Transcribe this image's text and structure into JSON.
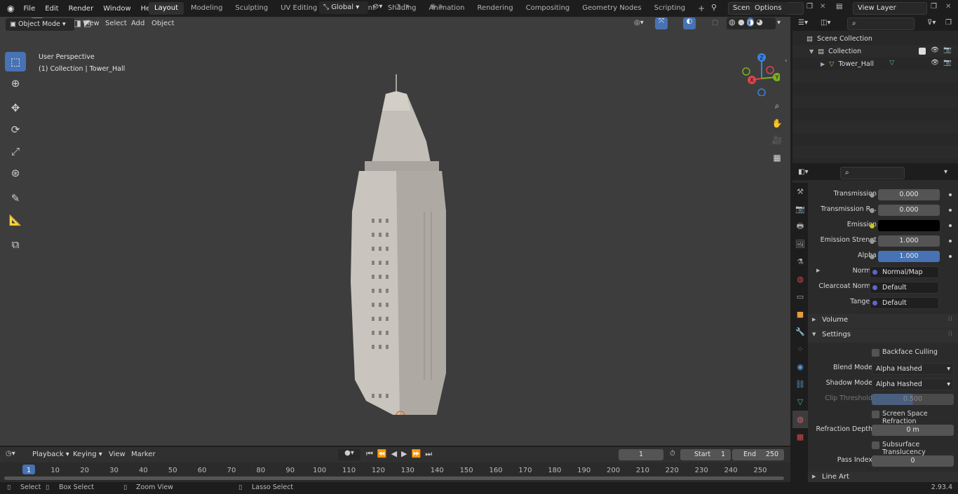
{
  "menu": [
    "File",
    "Edit",
    "Render",
    "Window",
    "Help"
  ],
  "workspaces": [
    "Layout",
    "Modeling",
    "Sculpting",
    "UV Editing",
    "Texture Paint",
    "Shading",
    "Animation",
    "Rendering",
    "Compositing",
    "Geometry Nodes",
    "Scripting"
  ],
  "scene_name": "Scene",
  "view_layer": "View Layer",
  "header": {
    "transform_orientation": "Global",
    "options": "Options"
  },
  "viewport_header": {
    "mode": "Object Mode",
    "view": "View",
    "select": "Select",
    "add": "Add",
    "object": "Object"
  },
  "viewport": {
    "perspective": "User Perspective",
    "context": "(1) Collection | Tower_Hall",
    "gizmo_z": "Z",
    "gizmo_y": "Y",
    "gizmo_x": "X"
  },
  "outliner": {
    "scene_collection": "Scene Collection",
    "collection": "Collection",
    "object": "Tower_Hall"
  },
  "properties": {
    "transmission": {
      "label": "Transmission",
      "value": "0.000"
    },
    "transmission_r": {
      "label": "Transmission R...",
      "value": "0.000"
    },
    "emission": {
      "label": "Emission"
    },
    "emission_strength": {
      "label": "Emission Strengt",
      "value": "1.000"
    },
    "alpha": {
      "label": "Alpha",
      "value": "1.000"
    },
    "normal": {
      "label": "Normal",
      "value": "Normal/Map"
    },
    "clearcoat_normal": {
      "label": "Clearcoat Normal",
      "value": "Default"
    },
    "tangent": {
      "label": "Tangent",
      "value": "Default"
    },
    "volume": "Volume",
    "settings": "Settings",
    "backface": "Backface Culling",
    "blend_mode": {
      "label": "Blend Mode",
      "value": "Alpha Hashed"
    },
    "shadow_mode": {
      "label": "Shadow Mode",
      "value": "Alpha Hashed"
    },
    "clip_threshold": {
      "label": "Clip Threshold",
      "value": "0.500"
    },
    "ssr": "Screen Space Refraction",
    "refraction_depth": {
      "label": "Refraction Depth",
      "value": "0 m"
    },
    "subsurface": "Subsurface Translucency",
    "pass_index": {
      "label": "Pass Index",
      "value": "0"
    },
    "line_art": "Line Art"
  },
  "timeline": {
    "playback": "Playback",
    "keying": "Keying",
    "view": "View",
    "marker": "Marker",
    "current_frame": "1",
    "start_label": "Start",
    "start": "1",
    "end_label": "End",
    "end": "250",
    "ticks": [
      "1",
      "10",
      "20",
      "30",
      "40",
      "50",
      "60",
      "70",
      "80",
      "90",
      "100",
      "110",
      "120",
      "130",
      "140",
      "150",
      "160",
      "170",
      "180",
      "190",
      "200",
      "210",
      "220",
      "230",
      "240",
      "250"
    ]
  },
  "status": {
    "select": "Select",
    "box_select": "Box Select",
    "zoom_view": "Zoom View",
    "lasso_select": "Lasso Select",
    "version": "2.93.4"
  },
  "colors": {
    "accent": "#4772b3",
    "bg": "#1d1d1d",
    "viewport": "#3d3d3d",
    "gizmo_x": "#e0434b",
    "gizmo_y": "#7bb01e",
    "gizmo_z": "#3a83e0"
  }
}
